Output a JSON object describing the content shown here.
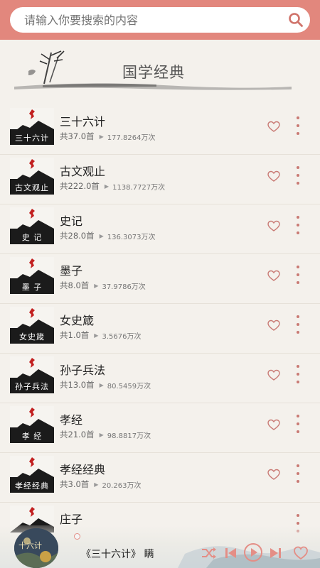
{
  "search": {
    "placeholder": "请输入你要搜索的内容"
  },
  "banner": {
    "title": "国学经典"
  },
  "items": [
    {
      "title": "三十六计",
      "thumb_text": "三十六计",
      "count": "共37.0首",
      "plays": "177.8264万次"
    },
    {
      "title": "古文观止",
      "thumb_text": "古文观止",
      "count": "共222.0首",
      "plays": "1138.7727万次"
    },
    {
      "title": "史记",
      "thumb_text": "史 记",
      "count": "共28.0首",
      "plays": "136.3073万次"
    },
    {
      "title": "墨子",
      "thumb_text": "墨 子",
      "count": "共8.0首",
      "plays": "37.9786万次"
    },
    {
      "title": "女史箴",
      "thumb_text": "女史箴",
      "count": "共1.0首",
      "plays": "3.5676万次"
    },
    {
      "title": "孙子兵法",
      "thumb_text": "孙子兵法",
      "count": "共13.0首",
      "plays": "80.5459万次"
    },
    {
      "title": "孝经",
      "thumb_text": "孝 经",
      "count": "共21.0首",
      "plays": "98.8817万次"
    },
    {
      "title": "孝经经典",
      "thumb_text": "孝经经典",
      "count": "共3.0首",
      "plays": "20.263万次"
    },
    {
      "title": "庄子",
      "thumb_text": "",
      "count": "",
      "plays": ""
    }
  ],
  "player": {
    "now_playing": "《三十六计》 瞒",
    "disc_text": "十六计"
  },
  "colors": {
    "accent": "#e2877d",
    "icon": "#c97a74"
  }
}
